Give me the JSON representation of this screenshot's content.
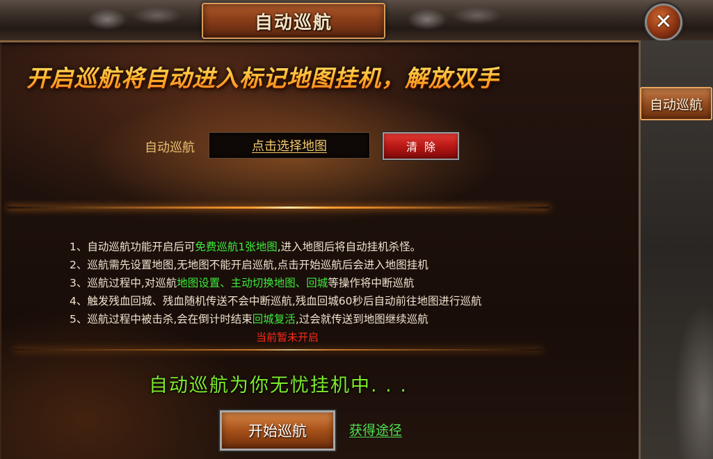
{
  "window": {
    "title": "自动巡航",
    "close_symbol": "✕"
  },
  "side_panel": {
    "tab_label": "自动巡航"
  },
  "headline": "开启巡航将自动进入标记地图挂机，解放双手",
  "map_selector": {
    "label": "自动巡航",
    "placeholder": "点击选择地图",
    "clear_label": "清除"
  },
  "rules": [
    {
      "prefix": "1、自动巡航功能开启后可",
      "highlight": "免费巡航1张地图",
      "suffix": ",进入地图后将自动挂机杀怪。"
    },
    {
      "prefix": "2、巡航需先设置地图,无地图不能开启巡航,点击开始巡航后会进入地图挂机",
      "highlight": "",
      "suffix": ""
    },
    {
      "prefix": "3、巡航过程中,对巡航",
      "highlight": "地图设置、主动切换地图、回城",
      "suffix": "等操作将中断巡航"
    },
    {
      "prefix": "4、触发残血回城、残血随机传送不会中断巡航,残血回城60秒后自动前往地图进行巡航",
      "highlight": "",
      "suffix": ""
    },
    {
      "prefix": "5、巡航过程中被击杀,会在倒计时结束",
      "highlight": "回城复活",
      "suffix": ",过会就传送到地图继续巡航"
    }
  ],
  "status_text": "当前暂未开启",
  "cruise_message": "自动巡航为你无忧挂机中. . .",
  "start_button_label": "开始巡航",
  "obtain_link_label": "获得途径",
  "colors": {
    "highlight_green": "#3dea3d",
    "status_red": "#ff2a1a",
    "headline_gold": "#ffb22c",
    "message_green": "#7eea2c"
  }
}
